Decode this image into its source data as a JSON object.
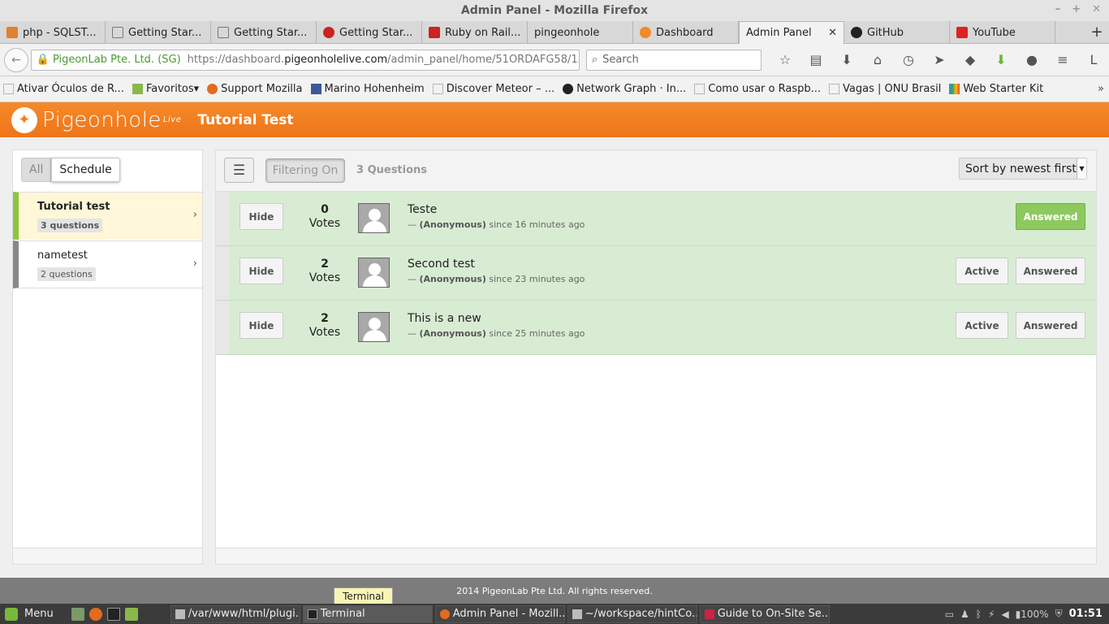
{
  "window": {
    "title": "Admin Panel - Mozilla Firefox"
  },
  "tabs": [
    {
      "label": "php - SQLST...",
      "color": "#e08030"
    },
    {
      "label": "Getting Star...",
      "color": "#777777"
    },
    {
      "label": "Getting Star...",
      "color": "#777777"
    },
    {
      "label": "Getting Star...",
      "color": "#cc2222"
    },
    {
      "label": "Ruby on Rail...",
      "color": "#cc2222"
    },
    {
      "label": "pingeonhole",
      "color": ""
    },
    {
      "label": "Dashboard",
      "color": "#f08a2a"
    },
    {
      "label": "Admin Panel",
      "color": "",
      "active": true,
      "close": "✕"
    },
    {
      "label": "GitHub",
      "color": "#222222"
    },
    {
      "label": "YouTube",
      "color": "#dd2222"
    }
  ],
  "newtab": "+",
  "nav": {
    "back": "←",
    "site_identity": "PigeonLab Pte. Ltd. (SG)",
    "url_prefix": "https://dashboard.",
    "url_domain": "pigeonholelive.com",
    "url_path": "/admin_panel/home/51ORDAFG58/15614",
    "search_placeholder": "Search"
  },
  "bookmarks": [
    "Ativar Óculos de R...",
    "Favoritos",
    "Support Mozilla",
    "Marino Hohenheim",
    "Discover Meteor – ...",
    "Network Graph · In...",
    "Como usar o Raspb...",
    "Vagas | ONU Brasil",
    "Web Starter Kit"
  ],
  "app": {
    "logo_text": "Pigeonhole",
    "logo_sup": "Live",
    "event_title": "Tutorial Test",
    "brand_color": "#f08020"
  },
  "sidebar": {
    "toggle_all": "All",
    "toggle_schedule": "Schedule",
    "sessions": [
      {
        "name": "Tutorial test",
        "count": "3 questions",
        "selected": true
      },
      {
        "name": "nametest",
        "count": "2 questions"
      }
    ]
  },
  "toolbar": {
    "filter_label": "Filtering On",
    "question_count": "3 Questions",
    "sort_label": "Sort by newest first"
  },
  "questions": [
    {
      "hide": "Hide",
      "votes": "0",
      "votes_label": "Votes",
      "text": "Teste",
      "author": "(Anonymous)",
      "time": "since 16 minutes ago",
      "answered": "Answered"
    },
    {
      "hide": "Hide",
      "votes": "2",
      "votes_label": "Votes",
      "text": "Second test",
      "author": "(Anonymous)",
      "time": "since 23 minutes ago",
      "active": "Active",
      "answered": "Answered"
    },
    {
      "hide": "Hide",
      "votes": "2",
      "votes_label": "Votes",
      "text": "This is a new",
      "author": "(Anonymous)",
      "time": "since 25 minutes ago",
      "active": "Active",
      "answered": "Answered"
    }
  ],
  "footer": {
    "copyright": "2014 PigeonLab Pte Ltd. All rights reserved."
  },
  "tooltip": "Terminal",
  "taskbar": {
    "menu": "Menu",
    "tasks": [
      "/var/www/html/plugi...",
      "Terminal",
      "Admin Panel - Mozill...",
      "~/workspace/hintCo...",
      "Guide to On-Site Se..."
    ],
    "battery": "100%",
    "clock": "01:51"
  }
}
